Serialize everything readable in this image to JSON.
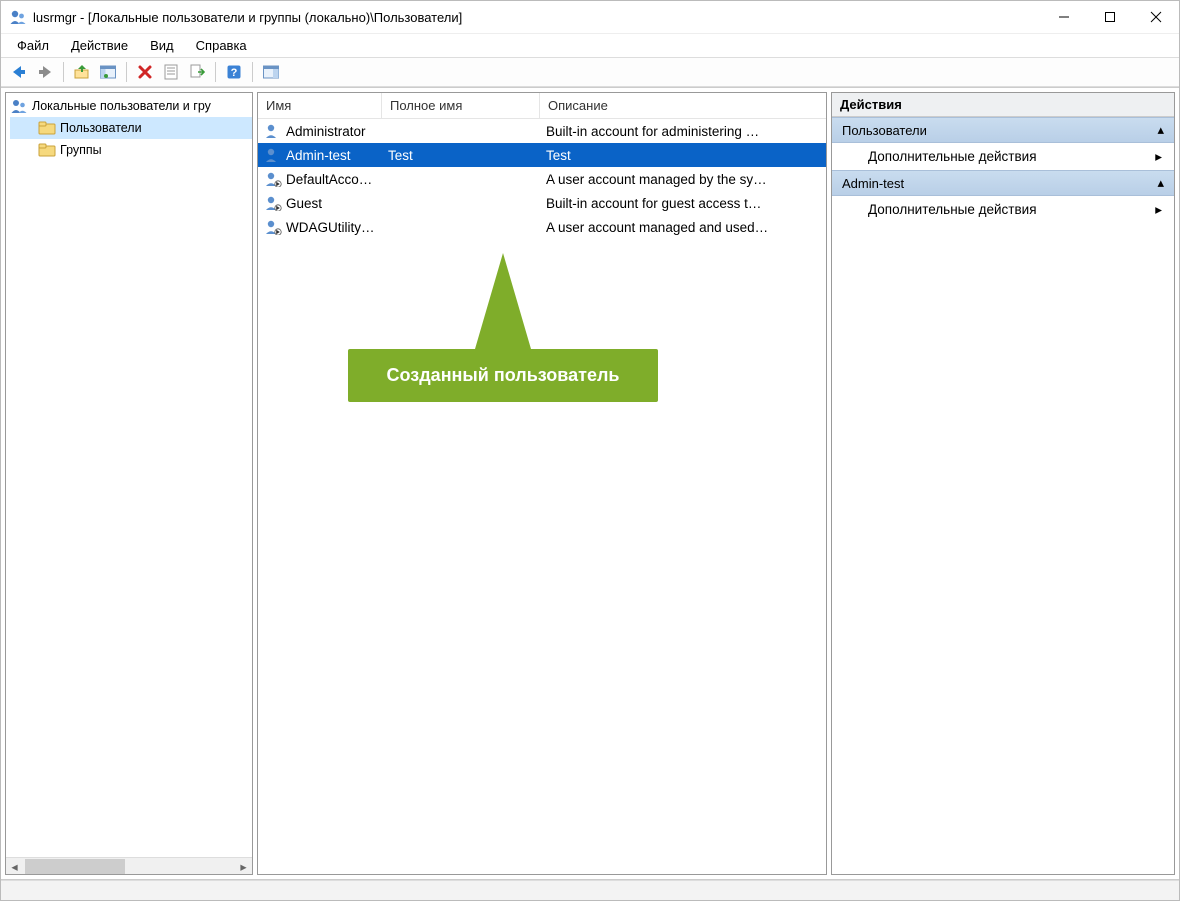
{
  "window": {
    "title": "lusrmgr - [Локальные пользователи и группы (локально)\\Пользователи]"
  },
  "menubar": {
    "file": "Файл",
    "action": "Действие",
    "view": "Вид",
    "help": "Справка"
  },
  "tree": {
    "root": "Локальные пользователи и гру",
    "users": "Пользователи",
    "groups": "Группы"
  },
  "columns": {
    "name": "Имя",
    "fullname": "Полное имя",
    "description": "Описание"
  },
  "users": [
    {
      "name": "Administrator",
      "full": "",
      "desc": "Built-in account for administering …",
      "selected": false,
      "disabled": false
    },
    {
      "name": "Admin-test",
      "full": "Test",
      "desc": "Test",
      "selected": true,
      "disabled": false
    },
    {
      "name": "DefaultAcco…",
      "full": "",
      "desc": "A user account managed by the sy…",
      "selected": false,
      "disabled": true
    },
    {
      "name": "Guest",
      "full": "",
      "desc": "Built-in account for guest access t…",
      "selected": false,
      "disabled": true
    },
    {
      "name": "WDAGUtility…",
      "full": "",
      "desc": "A user account managed and used…",
      "selected": false,
      "disabled": true
    }
  ],
  "actions": {
    "title": "Действия",
    "groups": [
      {
        "label": "Пользователи",
        "items": [
          {
            "label": "Дополнительные действия"
          }
        ]
      },
      {
        "label": "Admin-test",
        "items": [
          {
            "label": "Дополнительные действия"
          }
        ]
      }
    ]
  },
  "callout": {
    "text": "Созданный пользователь"
  },
  "colors": {
    "selection": "#0a63c7",
    "callout": "#7fad2a",
    "paneHead": "#c3d7ec"
  }
}
